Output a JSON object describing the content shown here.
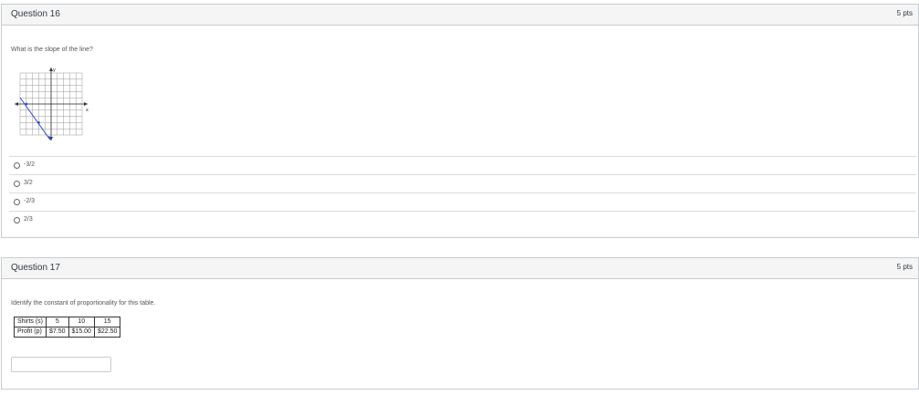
{
  "q16": {
    "title": "Question 16",
    "points": "5 pts",
    "text": "What is the slope of the line?",
    "graph": {
      "x_label": "x",
      "y_label": "y"
    },
    "answers": [
      {
        "label": "-3/2"
      },
      {
        "label": "3/2"
      },
      {
        "label": "-2/3"
      },
      {
        "label": "2/3"
      }
    ]
  },
  "q17": {
    "title": "Question 17",
    "points": "5 pts",
    "text": "Identify the constant of proportionality for this table.",
    "table": {
      "row1": [
        "Shirts (s)",
        "5",
        "10",
        "15"
      ],
      "row2": [
        "Profit (p)",
        "$7.50",
        "$15.00",
        "$22.50"
      ]
    },
    "answer_value": ""
  }
}
